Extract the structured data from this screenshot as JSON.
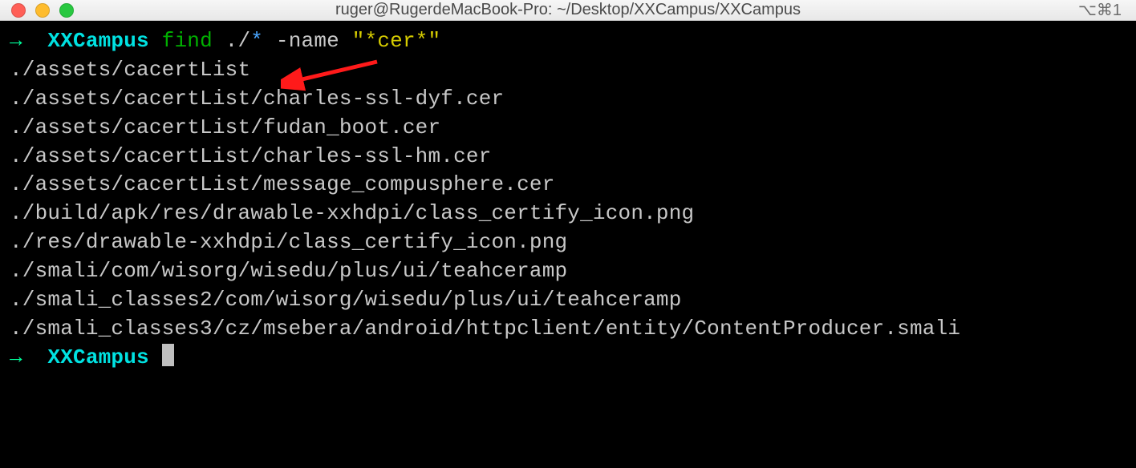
{
  "window": {
    "title": "ruger@RugerdeMacBook-Pro: ~/Desktop/XXCampus/XXCampus",
    "right_icon": "⌥⌘1"
  },
  "prompt1": {
    "arrow": "→",
    "dir": "XXCampus",
    "cmd": "find",
    "path_prefix": " ./",
    "star": "*",
    "flag": " -name ",
    "pattern": "\"*cer*\""
  },
  "output": [
    "./assets/cacertList",
    "./assets/cacertList/charles-ssl-dyf.cer",
    "./assets/cacertList/fudan_boot.cer",
    "./assets/cacertList/charles-ssl-hm.cer",
    "./assets/cacertList/message_compusphere.cer",
    "./build/apk/res/drawable-xxhdpi/class_certify_icon.png",
    "./res/drawable-xxhdpi/class_certify_icon.png",
    "./smali/com/wisorg/wisedu/plus/ui/teahceramp",
    "./smali_classes2/com/wisorg/wisedu/plus/ui/teahceramp",
    "./smali_classes3/cz/msebera/android/httpclient/entity/ContentProducer.smali"
  ],
  "prompt2": {
    "arrow": "→",
    "dir": "XXCampus"
  }
}
